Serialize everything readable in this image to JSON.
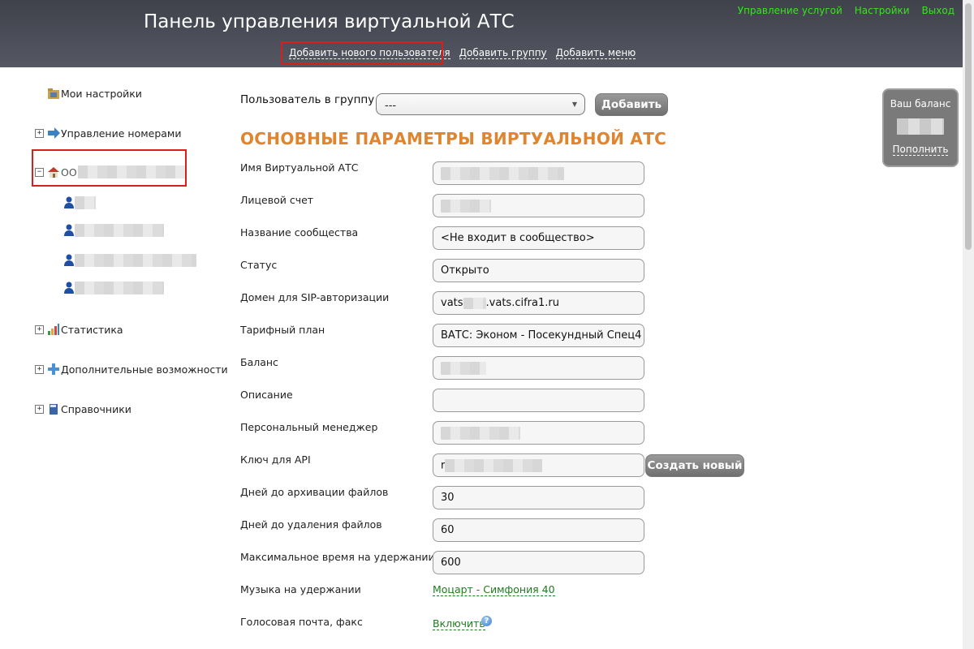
{
  "header": {
    "title": "Панель управления виртуальной АТС",
    "top_links": {
      "service": "Управление услугой",
      "settings": "Настройки",
      "logout": "Выход"
    },
    "actions": {
      "add_user": "Добавить нового пользователя",
      "add_group": "Добавить группу",
      "add_menu": "Добавить меню"
    }
  },
  "sidebar": {
    "my_settings": "Мои настройки",
    "numbers": "Управление номерами",
    "org_prefix": "ОО",
    "statistics": "Статистика",
    "extra": "Дополнительные возможности",
    "directories": "Справочники",
    "toggle_plus": "+",
    "toggle_minus": "−"
  },
  "group_row": {
    "label": "Пользователь в группу",
    "select_value": "---",
    "add_button": "Добавить"
  },
  "section": {
    "title": "ОСНОВНЫЕ ПАРАМЕТРЫ ВИРТУАЛЬНОЙ АТС",
    "fields": {
      "vats_name": {
        "label": "Имя Виртуальной АТС"
      },
      "account": {
        "label": "Лицевой счет"
      },
      "community": {
        "label": "Название сообщества",
        "value": "<Не входит в сообщество>"
      },
      "status": {
        "label": "Статус",
        "value": "Открыто"
      },
      "sip_domain": {
        "label": "Домен для SIP-авторизации",
        "value_prefix": "vats",
        "value_suffix": ".vats.cifra1.ru"
      },
      "tariff": {
        "label": "Тарифный план",
        "value": "ВАТС: Эконом - Посекундный Спец4"
      },
      "balance": {
        "label": "Баланс"
      },
      "description": {
        "label": "Описание",
        "value": ""
      },
      "manager": {
        "label": "Персональный менеджер"
      },
      "api_key": {
        "label": "Ключ для API",
        "value_prefix": "r",
        "button": "Создать новый"
      },
      "archive_days": {
        "label": "Дней до архивации файлов",
        "value": "30"
      },
      "delete_days": {
        "label": "Дней до удаления файлов",
        "value": "60"
      },
      "hold_time": {
        "label": "Максимальное время на удержании",
        "value": "600"
      },
      "hold_music": {
        "label": "Музыка на удержании",
        "value": "Моцарт - Симфония 40"
      },
      "voicemail": {
        "label": "Голосовая почта, факс",
        "value": "Включить",
        "help": "?"
      }
    }
  },
  "balance_box": {
    "title": "Ваш баланс",
    "link": "Пополнить"
  },
  "colors": {
    "accent_orange": "#e0842e",
    "link_green": "#39e51e",
    "highlight_red": "#d91e1e",
    "header_bg": "#484b55"
  },
  "icons": [
    "folder-settings-icon",
    "arrow-right-icon",
    "house-icon",
    "user-icon",
    "bar-chart-icon",
    "plus-cross-icon",
    "book-icon",
    "help-icon",
    "chevron-down-icon"
  ]
}
